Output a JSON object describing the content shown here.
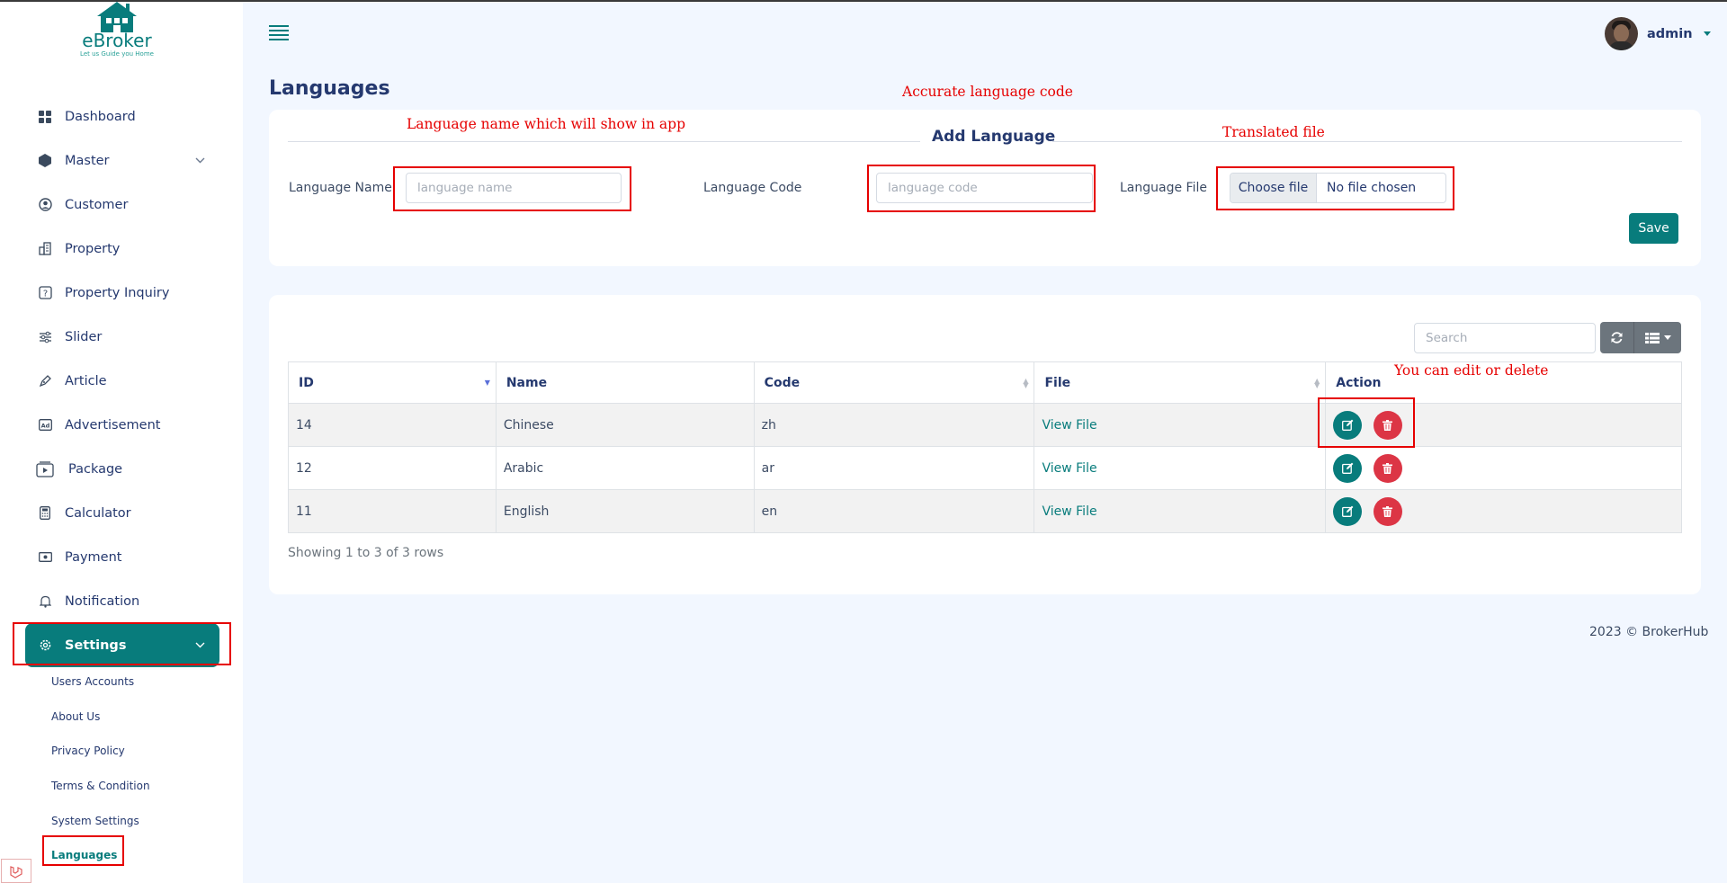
{
  "app": {
    "logo_name": "eBroker",
    "logo_tagline": "Let us Guide you Home",
    "brand_color": "#087c7c"
  },
  "sidebar": {
    "items": [
      {
        "label": "Dashboard",
        "icon": "grid-icon"
      },
      {
        "label": "Master",
        "icon": "hexagon-icon",
        "has_chevron": true
      },
      {
        "label": "Customer",
        "icon": "user-circle-icon"
      },
      {
        "label": "Property",
        "icon": "building-icon"
      },
      {
        "label": "Property Inquiry",
        "icon": "question-square-icon"
      },
      {
        "label": "Slider",
        "icon": "sliders-icon"
      },
      {
        "label": "Article",
        "icon": "pen-icon"
      },
      {
        "label": "Advertisement",
        "icon": "ad-icon"
      },
      {
        "label": "Package",
        "icon": "package-icon"
      },
      {
        "label": "Calculator",
        "icon": "calculator-icon"
      },
      {
        "label": "Payment",
        "icon": "cash-icon"
      },
      {
        "label": "Notification",
        "icon": "bell-icon"
      },
      {
        "label": "Settings",
        "icon": "gear-icon",
        "has_chevron": true,
        "active": true
      }
    ],
    "submenu": [
      {
        "label": "Users Accounts"
      },
      {
        "label": "About Us"
      },
      {
        "label": "Privacy Policy"
      },
      {
        "label": "Terms & Condition"
      },
      {
        "label": "System Settings"
      },
      {
        "label": "Languages",
        "active": true
      }
    ]
  },
  "header": {
    "user_name": "admin"
  },
  "page": {
    "title": "Languages"
  },
  "form": {
    "legend": "Add Language",
    "name_label": "Language Name",
    "name_placeholder": "language name",
    "code_label": "Language Code",
    "code_placeholder": "language code",
    "file_label": "Language File",
    "file_button": "Choose file",
    "file_status": "No file chosen",
    "save_label": "Save"
  },
  "annotations": {
    "name_note": "Language  name  which  will  show  in  app",
    "code_note": "Accurate  language  code",
    "file_note": "Translated  file",
    "action_note": "You  can  edit  or  delete"
  },
  "table": {
    "search_placeholder": "Search",
    "columns": [
      "ID",
      "Name",
      "Code",
      "File",
      "Action"
    ],
    "rows": [
      {
        "id": "14",
        "name": "Chinese",
        "code": "zh",
        "file": "View File"
      },
      {
        "id": "12",
        "name": "Arabic",
        "code": "ar",
        "file": "View File"
      },
      {
        "id": "11",
        "name": "English",
        "code": "en",
        "file": "View File"
      }
    ],
    "summary": "Showing 1 to 3 of 3 rows"
  },
  "footer": {
    "text": "2023 © BrokerHub"
  },
  "colors": {
    "accent": "#087c7c",
    "danger": "#dc3545",
    "annotation": "#e60000",
    "background": "#f2f7ff"
  }
}
